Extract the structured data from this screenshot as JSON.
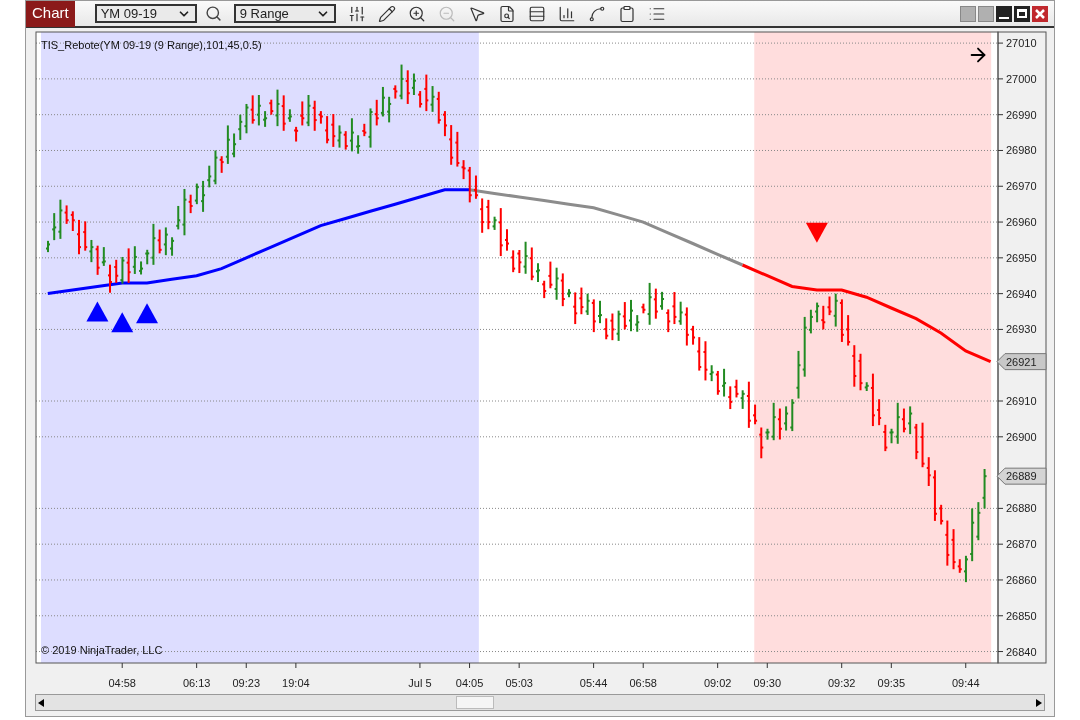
{
  "toolbar": {
    "title": "Chart",
    "instrument": "YM 09-19",
    "interval": "9 Range",
    "tools": [
      {
        "kind": "bar-style",
        "disabled": false
      },
      {
        "kind": "draw",
        "disabled": false
      },
      {
        "kind": "zoom-in",
        "disabled": false
      },
      {
        "kind": "zoom-out",
        "disabled": true
      },
      {
        "kind": "pointer",
        "disabled": false
      },
      {
        "kind": "data-box",
        "disabled": false
      },
      {
        "kind": "templates",
        "disabled": false
      },
      {
        "kind": "bars",
        "disabled": false
      },
      {
        "kind": "indicators",
        "disabled": false
      },
      {
        "kind": "strategies",
        "disabled": false
      },
      {
        "kind": "properties",
        "disabled": false
      }
    ]
  },
  "chart": {
    "indicator_label": "TIS_Rebote(YM 09-19 (9 Range),101,45,0.5)",
    "copyright": "© 2019 NinjaTrader, LLC",
    "price_markers": [
      {
        "label": "26921",
        "kind": "indicator"
      },
      {
        "label": "26889",
        "kind": "last"
      }
    ],
    "chart_data": {
      "type": "line",
      "categories": [
        null,
        null,
        null,
        "04:58",
        null,
        null,
        "06:13",
        null,
        "09:23",
        null,
        "19:04",
        null,
        null,
        null,
        null,
        "Jul 5",
        null,
        "04:05",
        null,
        "05:03",
        null,
        null,
        "05:44",
        null,
        "06:58",
        null,
        null,
        "09:02",
        null,
        "09:30",
        null,
        null,
        "09:32",
        null,
        "09:35",
        null,
        null,
        "09:44",
        null
      ],
      "ylim": [
        26836.8,
        27013.1
      ],
      "grid": true,
      "yticks": [
        {
          "value": 27010,
          "label": "27010"
        },
        {
          "value": 27000,
          "label": "27000"
        },
        {
          "value": 26990,
          "label": "26990"
        },
        {
          "value": 26980,
          "label": "26980"
        },
        {
          "value": 26970,
          "label": "26970"
        },
        {
          "value": 26960,
          "label": "26960"
        },
        {
          "value": 26950,
          "label": "26950"
        },
        {
          "value": 26940,
          "label": "26940"
        },
        {
          "value": 26930,
          "label": "26930"
        },
        {
          "value": 26910,
          "label": "26910"
        },
        {
          "value": 26900,
          "label": "26900"
        },
        {
          "value": 26880,
          "label": "26880"
        },
        {
          "value": 26870,
          "label": "26870"
        },
        {
          "value": 26860,
          "label": "26860"
        },
        {
          "value": 26850,
          "label": "26850"
        },
        {
          "value": 26840,
          "label": "26840"
        }
      ],
      "series": [
        {
          "color": "#0000ff",
          "values": [
            26940,
            26941,
            26942,
            26943,
            26943,
            26944,
            26945,
            26947,
            26950,
            26953,
            26956,
            26959,
            26961,
            26963,
            26965,
            26967,
            26969,
            26969,
            null,
            null,
            null,
            null,
            null,
            null,
            null,
            null,
            null,
            null,
            null,
            null,
            null,
            null,
            null,
            null,
            null,
            null,
            null,
            null,
            null
          ]
        },
        {
          "color": "#8c8c8c",
          "values": [
            null,
            null,
            null,
            null,
            null,
            null,
            null,
            null,
            null,
            null,
            null,
            null,
            null,
            null,
            null,
            null,
            null,
            26969,
            26968,
            26967,
            26966,
            26965,
            26964,
            26962,
            26960,
            26957,
            26954,
            26951,
            26948,
            null,
            null,
            null,
            null,
            null,
            null,
            null,
            null,
            null,
            null
          ]
        },
        {
          "color": "#ff0000",
          "values": [
            null,
            null,
            null,
            null,
            null,
            null,
            null,
            null,
            null,
            null,
            null,
            null,
            null,
            null,
            null,
            null,
            null,
            null,
            null,
            null,
            null,
            null,
            null,
            null,
            null,
            null,
            null,
            null,
            26948,
            26945,
            26942,
            26941,
            26941,
            26939,
            26936,
            26933,
            26929,
            26924,
            26921
          ]
        },
        {
          "type": "scatter",
          "color": "#0000ff",
          "values": [
            null,
            null,
            26935,
            26932,
            26934.5,
            null,
            null,
            null,
            null,
            null,
            null,
            null,
            null,
            null,
            null,
            null,
            null,
            null,
            null,
            null,
            null,
            null,
            null,
            null,
            null,
            null,
            null,
            null,
            null,
            null,
            null,
            null,
            null,
            null,
            null,
            null,
            null,
            null,
            null
          ]
        },
        {
          "type": "scatter",
          "color": "#ff0000",
          "values": [
            null,
            null,
            null,
            null,
            null,
            null,
            null,
            null,
            null,
            null,
            null,
            null,
            null,
            null,
            null,
            null,
            null,
            null,
            null,
            null,
            null,
            null,
            null,
            null,
            null,
            null,
            null,
            null,
            null,
            null,
            null,
            26957,
            null,
            null,
            null,
            null,
            null,
            null,
            null
          ]
        }
      ]
    }
  }
}
